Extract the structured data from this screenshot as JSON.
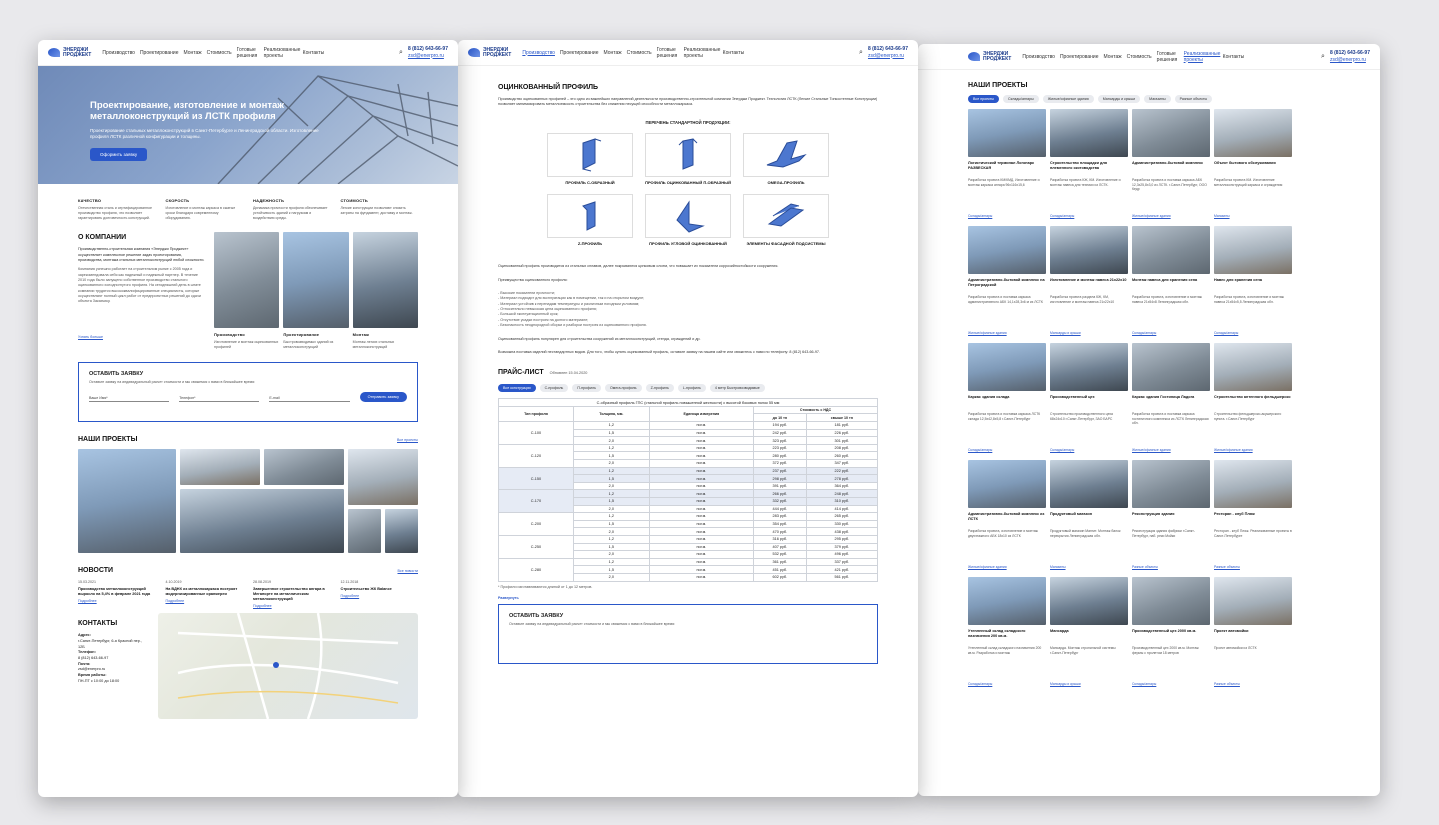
{
  "common": {
    "logo_top": "ЭНЕРДЖИ",
    "logo_bottom": "ПРОДЖЕКТ",
    "phone": "8 (812) 643-66-97",
    "email": "zsd@enerpro.ru",
    "nav": [
      "Производство",
      "Проектирование",
      "Монтаж",
      "Стоимость",
      "Готовые решения",
      "Реализованные проекты",
      "Контакты"
    ]
  },
  "page1": {
    "hero_title": "Проектирование, изготовление и монтаж металлоконструкций из ЛСТК профиля",
    "hero_sub": "Проектирование стальных металлоконструкций в Санкт-Петербурге и Ленинградской области. Изготовление профиля ЛСТК различной конфигурации и толщины.",
    "hero_btn": "Оформить заявку",
    "features": [
      {
        "t": "КАЧЕСТВО",
        "d": "Отечественная сталь и сертифицированное производство профиля, что позволяет гарантировать долговечность конструкций."
      },
      {
        "t": "СКОРОСТЬ",
        "d": "Изготовление и монтаж каркаса в сжатые сроки благодаря современному оборудованию."
      },
      {
        "t": "НАДЕЖНОСТЬ",
        "d": "Динамика прочности профиля обеспечивает устойчивость зданий к нагрузкам и воздействию среды."
      },
      {
        "t": "СТОИМОСТЬ",
        "d": "Легкие конструкции позволяют снизить затраты на фундамент, доставку и монтаж."
      }
    ],
    "about_title": "О КОМПАНИИ",
    "about_lead": "Производственно-строительная компания «Энерджи Проджект» осуществляет комплексное решение задач проектирования, производства, монтажа стальных металлоконструкций любой сложности.",
    "about_text": "Компания успешно работает на строительном рынке с 2005 года и зарекомендовала себя как надежный и надежный партнер. В течение 2010 года было запущено собственное производство стального оцинкованного холодногнутого профиля. На сегодняшний день в штате компании трудятся высококвалифицированные специалисты, которые осуществляют полный цикл работ от предпроектных решений до сдачи объекта Заказчику.",
    "about_more": "Узнать больше",
    "about_cards": [
      {
        "t": "Производство",
        "d": "Изготовление и монтаж оцинкованных профилей"
      },
      {
        "t": "Проектирование",
        "d": "Быстровозводимых зданий из металлоконструкций"
      },
      {
        "t": "Монтаж",
        "d": "Монтаж легких стальных металлоконструкций"
      }
    ],
    "order_title": "ОСТАВИТЬ ЗАЯВКУ",
    "order_sub": "Оставьте заявку на индивидуальный расчет стоимости и мы свяжемся с вами в ближайшее время:",
    "order_name": "Ваше Имя*",
    "order_phone": "Телефон*",
    "order_email": "E-mail",
    "order_btn": "Отправить заявку",
    "projects_title": "НАШИ ПРОЕКТЫ",
    "projects_all": "Все проекты",
    "news_title": "НОВОСТИ",
    "news_all": "Все новости",
    "news": [
      {
        "date": "15.03.2021",
        "t": "Производство металлоконструкций выросло на 5,4% в феврале 2021 года",
        "more": "Подробнее"
      },
      {
        "date": "4.10.2019",
        "t": "На ВДНХ из металлокаркаса построят модернизированные оранжереи",
        "more": "Подробнее"
      },
      {
        "date": "28.08.2019",
        "t": "Завершенное строительство ангара в Мегапорте на металлическом металлоконструкций",
        "more": "Подробнее"
      },
      {
        "date": "12.11.2018",
        "t": "Строительство ЖК Balance",
        "more": "Подробнее"
      }
    ],
    "contacts_title": "КОНТАКТЫ",
    "addr_label": "Адрес:",
    "addr": "г.Санкт-Петербург, 6-я Красной пер., 12Б",
    "tel_label": "Телефон:",
    "tel": "8 (812) 643-66-97",
    "mail_label": "Почта:",
    "mail": "zsd@enerpro.ru",
    "hours_label": "Время работы:",
    "hours": "ПН-ПТ с 10:00 до 18:00"
  },
  "page2": {
    "title": "ОЦИНКОВАННЫЙ ПРОФИЛЬ",
    "intro": "Производство оцинкованных профилей – это одно из важнейших направлений деятельности производственно-строительной компании Энерджи Проджект. Технология ЛСТК (Легкие Стальные Тонкостенные Конструкции) позволяет минимизировать металлоемкость строительства без снижения несущей способности металлокаркаса.",
    "list_title": "ПЕРЕЧЕНЬ СТАНДАРТНОЙ ПРОДУКЦИИ:",
    "profiles": [
      "ПРОФИЛЬ С-ОБРАЗНЫЙ",
      "ПРОФИЛЬ ОЦИНКОВАННЫЙ П-ОБРАЗНЫЙ",
      "OMEGA-ПРОФИЛЬ",
      "Z-ПРОФИЛЬ",
      "ПРОФИЛЬ УГЛОВОЙ ОЦИНКОВАННЫЙ",
      "ЭЛЕМЕНТЫ ФАСАДНОЙ ПОДСИСТЕМЫ"
    ],
    "para1": "Оцинкованный профиль производится из стальных сплавов, далее покрываются цинковым слоем, что повышает их показатели коррозийностойкости сооружения.",
    "para2": "Преимущества оцинкованного профиля:",
    "bullets": [
      "- Высокие показатели прочности;",
      "- Материал подходит для эксплуатации как в помещении, так и на открытом воздухе;",
      "- Материал устойчив к перепадам температуры и различным погодным условиям;",
      "- Относительно невысокая цена оцинкованного профиля;",
      "- Большой эксплуатационный срок;",
      "- Отсутствие усадки построек на долгого материале;",
      "- Безопасность неоднородной сборки и разборки построек из оцинкованного профиля."
    ],
    "para3": "Оцинкованный профиль популярен для строительства сооружений из металлоконструкций, стенда, ограждений и др.",
    "para4": "Возможна поставка изделий нестандартных видов. Для того, чтобы купить оцинкованный профиль, оставьте заявку на нашем сайте или свяжитесь с нами по телефону: 8 (812) 643-66-97.",
    "price_title": "ПРАЙС-ЛИСТ",
    "price_date": "Обновлен 15.04.2020",
    "tabs": [
      "Все конструкции",
      "С-профиль",
      "П-профиль",
      "Омега-профиль",
      "Z-профиль",
      "L-профиль",
      "4 метр Быстровозводимые"
    ],
    "table_caption": "С-образный профиль ГПС (стальной профиль повышенной жесткости) с высотой боковых полок 55 мм",
    "th": [
      "Тип профиля",
      "Толщина, мм.",
      "Единица измерения",
      "Стоимость с НДС",
      "до 10 тн",
      "свыше 10 тн"
    ],
    "rows": [
      {
        "type": "С-100",
        "t": [
          "1,2",
          "1,5",
          "2,0"
        ],
        "a": [
          "194 руб.",
          "242 руб.",
          "323 руб."
        ],
        "b": [
          "181 руб.",
          "226 руб.",
          "301 руб."
        ]
      },
      {
        "type": "С-120",
        "t": [
          "1,2",
          "1,5",
          "2,0"
        ],
        "a": [
          "223 руб.",
          "280 руб.",
          "372 руб."
        ],
        "b": [
          "208 руб.",
          "260 руб.",
          "347 руб."
        ]
      },
      {
        "type": "С-150",
        "t": [
          "1,2",
          "1,5",
          "2,0"
        ],
        "a": [
          "237 руб.",
          "298 руб.",
          "391 руб."
        ],
        "b": [
          "222 руб.",
          "278 руб.",
          "364 руб."
        ]
      },
      {
        "type": "С-170",
        "t": [
          "1,2",
          "1,5",
          "2,0"
        ],
        "a": [
          "266 руб.",
          "332 руб.",
          "444 руб."
        ],
        "b": [
          "248 руб.",
          "310 руб.",
          "414 руб."
        ]
      },
      {
        "type": "С-200",
        "t": [
          "1,2",
          "1,5",
          "2,0"
        ],
        "a": [
          "283 руб.",
          "354 руб.",
          "470 руб."
        ],
        "b": [
          "265 руб.",
          "330 руб.",
          "438 руб."
        ]
      },
      {
        "type": "С-250",
        "t": [
          "1,2",
          "1,5",
          "2,0"
        ],
        "a": [
          "316 руб.",
          "407 руб.",
          "532 руб."
        ],
        "b": [
          "295 руб.",
          "379 руб.",
          "496 руб."
        ]
      },
      {
        "type": "С-280",
        "t": [
          "1,2",
          "1,5",
          "2,0"
        ],
        "a": [
          "361 руб.",
          "451 руб.",
          "602 руб."
        ],
        "b": [
          "337 руб.",
          "421 руб.",
          "561 руб."
        ]
      }
    ],
    "unit": "пог.м.",
    "note": "* Профили изготавливаются длиной от 1 до 12 метров.",
    "expand": "Развернуть",
    "order_title": "ОСТАВИТЬ ЗАЯВКУ",
    "order_sub": "Оставьте заявку на индивидуальный расчет стоимости и мы свяжемся с вами в ближайшее время:"
  },
  "page3": {
    "title": "НАШИ ПРОЕКТЫ",
    "cats": [
      "Все проекты",
      "Склады/ангары",
      "Жилые/офисные здания",
      "Мансарды и крыши",
      "Магазины",
      "Разные объекты"
    ],
    "projects": [
      {
        "n": "Логистический терминал Логопарк РАЗВЕСКАЯ",
        "d": "Разработка проекта КМ/КМД. Изготовление и монтаж каркаса ангара 96х116х15,6",
        "tag": "Склады/ангары"
      },
      {
        "n": "Строительство площадки для племенного скотоводства",
        "d": "Разработка проекта КЖ, КМ. Изготовление и монтаж навеса для техники из ЛСТК.",
        "tag": "Склады/ангары"
      },
      {
        "n": "Административно-бытовой комплекс",
        "d": "Разработка проекта и поставка каркаса АБК 12,3х25,8х3,0 из ЛСТК. г.Санкт-Петербург, ООО Кедр",
        "tag": "Жилые/офисные здания"
      },
      {
        "n": "Объект бытового обслуживания",
        "d": "Разработка проекта КМ. Изготовление металлоконструкций каркаса и ограждения",
        "tag": "Магазины"
      },
      {
        "n": "Административно-бытовой комплекс на Петроградской",
        "d": "Разработка проекта и поставка каркаса административного АБК 14,1х28,3х6 м из ЛСТК",
        "tag": "Жилые/офисные здания"
      },
      {
        "n": "Изготовление и монтаж навеса 21х22х10",
        "d": "Разработка проекта раздела КЖ, КМ, изготовление и монтаж навеса 21х22х10",
        "tag": "Мансарды и крыши"
      },
      {
        "n": "Монтаж навеса для хранения сена",
        "d": "Разработка проекта, изготовление и монтаж навеса 21х54х8 Ленинградская обл.",
        "tag": "Склады/ангары"
      },
      {
        "n": "Навес для хранения сена",
        "d": "Разработка проекта, изготовление и монтаж навеса 21х54х5,5 Ленинградская обл.",
        "tag": "Склады/ангары"
      },
      {
        "n": "Каркас здания склада",
        "d": "Разработка проекта и поставка каркаса ЛСТК склада 12,5х42,8х5,8 г.Санкт-Петербург",
        "tag": "Склады/ангары"
      },
      {
        "n": "Производственный цех",
        "d": "Строительство производственного цеха 68х24х10 г.Санкт-Петербург, ЗАО БАРС",
        "tag": "Склады/ангары"
      },
      {
        "n": "Каркас здания Гостиница Ладога",
        "d": "Разработка проекта и поставка каркаса гостиничного комплекса из ЛСТК Ленинградская обл.",
        "tag": "Жилые/офисные здания"
      },
      {
        "n": "Строительство антенного фельдшерско",
        "d": "Строительство фельдшерско-акушерского пункта. г.Санкт-Петербург",
        "tag": "Жилые/офисные здания"
      },
      {
        "n": "Административно-бытовой комплекс из ЛСТК",
        "d": "Разработка проекта, изготовление и монтаж двухэтажного АБК 18х10 из ЛСТК",
        "tag": "Жилые/офисные здания"
      },
      {
        "n": "Продуктовый магазин",
        "d": "Продуктовый магазин Магнит. Монтаж балок перекрытия Ленинградская обл.",
        "tag": "Магазины"
      },
      {
        "n": "Реконструкция здания",
        "d": "Реконструкция здания фабрики г.Санкт-Петербург, наб. реки Мойки",
        "tag": "Разные объекты"
      },
      {
        "n": "Ресторан - клуб Пляж",
        "d": "Ресторан - клуб Пляж. Реализованные проекты в Санкт-Петербурге",
        "tag": "Разные объекты"
      },
      {
        "n": "Утепленный склад складского назначения 200 кв.м.",
        "d": "Утепленный склад складского назначения 200 кв.м. Разработка и монтаж",
        "tag": "Склады/ангары"
      },
      {
        "n": "Мансарда",
        "d": "Мансарда. Монтаж стропильной системы г.Санкт-Петербург",
        "tag": "Мансарды и крыши"
      },
      {
        "n": "Производственный цех 2000 кв.м.",
        "d": "Производственный цех 2000 кв.м. Монтаж фермы с пролетом 18 метров",
        "tag": "Склады/ангары"
      },
      {
        "n": "Проект автомойки",
        "d": "Проект автомойки из ЛСТК",
        "tag": "Разные объекты"
      }
    ]
  }
}
